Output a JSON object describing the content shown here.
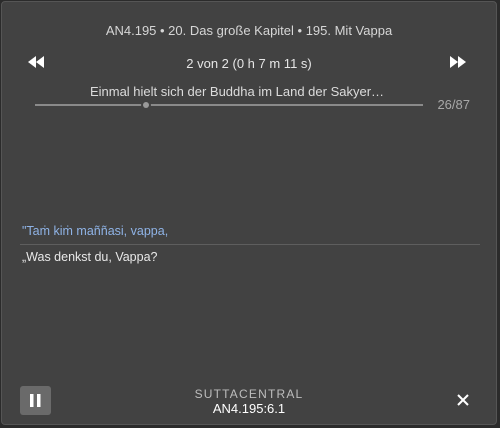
{
  "header": {
    "title": "AN4.195 • 20. Das große Kapitel • 195. Mit Vappa"
  },
  "navigation": {
    "prev_icon": "rewind-icon",
    "next_icon": "fast-forward-icon",
    "progress_text": "2 von 2 (0 h 7 m 11 s)"
  },
  "segment": {
    "current_text": "Einmal hielt sich der Buddha im Land der Sakyer…",
    "counter": "26/87",
    "position_fraction": 0.287
  },
  "content": {
    "pali": "\"Taṁ kiṁ maññasi, vappa,",
    "translation": "„Was denkst du, Vappa?"
  },
  "footer": {
    "brand": "SUTTACENTRAL",
    "segment_id": "AN4.195:6.1",
    "pause_icon": "pause-icon",
    "close_icon": "close-icon"
  },
  "colors": {
    "dialog_background": "#424242",
    "pali_text": "#8fb3e6",
    "translation_text": "#e8e8e8",
    "pause_button": "#6a6a6a"
  }
}
